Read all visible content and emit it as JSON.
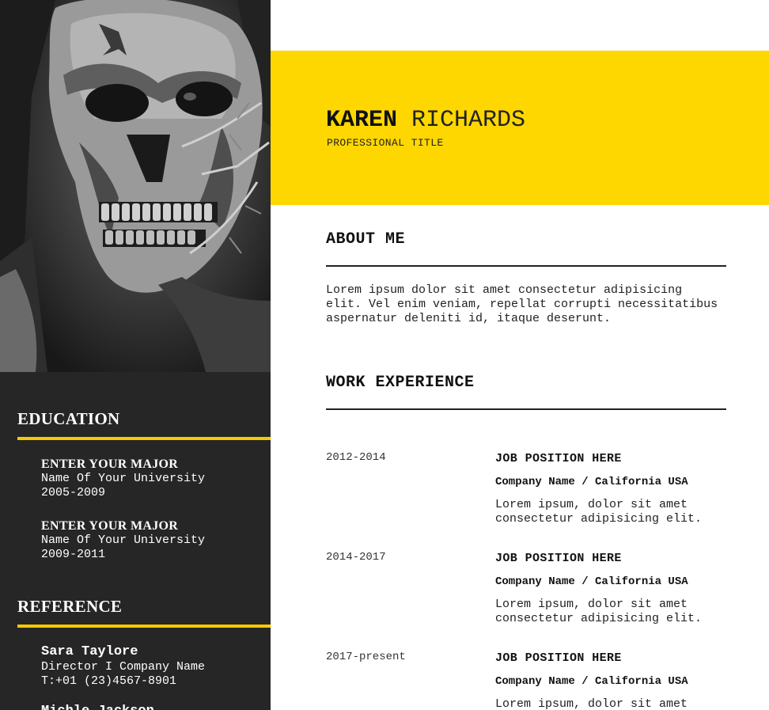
{
  "header": {
    "first_name": "KAREN",
    "last_name": "RICHARDS",
    "professional_title": "PROFESSIONAL TITLE"
  },
  "education": {
    "heading": "EDUCATION",
    "items": [
      {
        "major": "ENTER YOUR MAJOR",
        "university": "Name Of Your University",
        "years": "2005-2009"
      },
      {
        "major": "ENTER YOUR MAJOR",
        "university": "Name Of Your University",
        "years": "2009-2011"
      }
    ]
  },
  "reference": {
    "heading": "REFERENCE",
    "items": [
      {
        "name": "Sara Taylore",
        "role": "Director I Company Name",
        "phone": "T:+01 (23)4567-8901"
      },
      {
        "name": "Michle Jackson"
      }
    ]
  },
  "about": {
    "heading": "ABOUT ME",
    "text": "Lorem ipsum dolor sit amet consectetur adipisicing elit. Vel enim veniam, repellat corrupti necessitatibus aspernatur deleniti id, itaque deserunt."
  },
  "work": {
    "heading": "WORK EXPERIENCE",
    "jobs": [
      {
        "years": "2012-2014",
        "title": "JOB POSITION HERE",
        "company": "Company Name / California USA",
        "description": "Lorem ipsum, dolor sit amet consectetur adipisicing elit."
      },
      {
        "years": "2014-2017",
        "title": "JOB POSITION HERE",
        "company": "Company Name / California USA",
        "description": "Lorem ipsum, dolor sit amet consectetur adipisicing elit."
      },
      {
        "years": "2017-present",
        "title": "JOB POSITION HERE",
        "company": "Company Name / California USA",
        "description": "Lorem ipsum, dolor sit amet consectetur adipisicing elit."
      }
    ]
  },
  "colors": {
    "accent": "#fed700",
    "sidebar": "#262626",
    "rule_accent": "#f7c900"
  },
  "photo": {
    "icon": "skull-portrait-photo"
  }
}
